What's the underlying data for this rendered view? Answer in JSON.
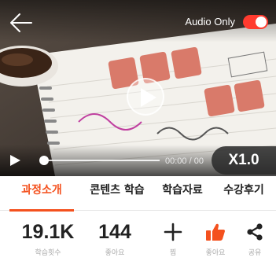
{
  "player": {
    "audio_only_label": "Audio Only",
    "audio_only_on": true,
    "time_text": "00:00 / 00",
    "speed_label": "X1.0",
    "progress": 0.0,
    "accent_color": "#ff3b2f"
  },
  "tabs": [
    {
      "label": "과정소개",
      "active": true
    },
    {
      "label": "콘텐츠 학습",
      "active": false
    },
    {
      "label": "학습자료",
      "active": false
    },
    {
      "label": "수강후기",
      "active": false
    }
  ],
  "stats": {
    "views": {
      "value": "19.1K",
      "label": "학습횟수"
    },
    "likes": {
      "value": "144",
      "label": "좋아요"
    },
    "add": {
      "icon": "plus-icon",
      "label": "찜"
    },
    "like_button": {
      "icon": "thumbs-up-icon",
      "label": "좋아요",
      "color": "#f4511e"
    },
    "share": {
      "icon": "share-icon",
      "label": "공유"
    }
  },
  "theme": {
    "active_tab_color": "#f4511e"
  }
}
